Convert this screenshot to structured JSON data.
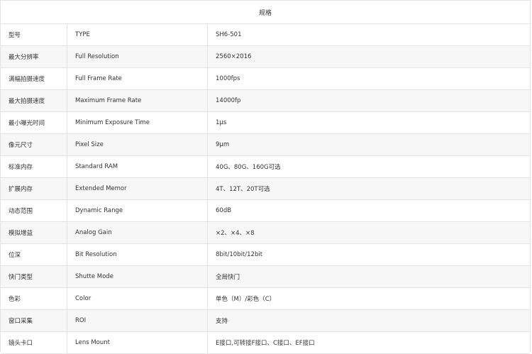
{
  "title": "规格",
  "rows": [
    {
      "zh": "型号",
      "en": "TYPE",
      "value": "SH6-501"
    },
    {
      "zh": "最大分辨率",
      "en": "Full Resolution",
      "value": "2560×2016"
    },
    {
      "zh": "满幅拍摄速度",
      "en": "Full Frame Rate",
      "value": "1000fps"
    },
    {
      "zh": "最大拍摄速度",
      "en": "Maximum Frame Rate",
      "value": "14000fp"
    },
    {
      "zh": "最小曝光时间",
      "en": "Minimum Exposure Time",
      "value": "1μs"
    },
    {
      "zh": "像元尺寸",
      "en": "Pixel Size",
      "value": "9μm"
    },
    {
      "zh": "标准内存",
      "en": "Standard RAM",
      "value": "40G、80G、160G可选"
    },
    {
      "zh": "扩展内存",
      "en": "Extended Memor",
      "value": "4T、12T、20T可选"
    },
    {
      "zh": "动态范围",
      "en": "Dynamic Range",
      "value": "60dB"
    },
    {
      "zh": "模拟增益",
      "en": "Analog Gain",
      "value": "×2、×4、×8"
    },
    {
      "zh": "位深",
      "en": "Bit Resolution",
      "value": "8bit/10bit/12bit"
    },
    {
      "zh": "快门类型",
      "en": "Shutte Mode",
      "value": "全局快门"
    },
    {
      "zh": "色彩",
      "en": "Color",
      "value": "单色（M）/彩色（C）"
    },
    {
      "zh": "窗口采集",
      "en": "ROI",
      "value": "支持"
    },
    {
      "zh": "镜头卡口",
      "en": "Lens Mount",
      "value": "E接口,可转接F接口、C接口、EF接口"
    }
  ]
}
